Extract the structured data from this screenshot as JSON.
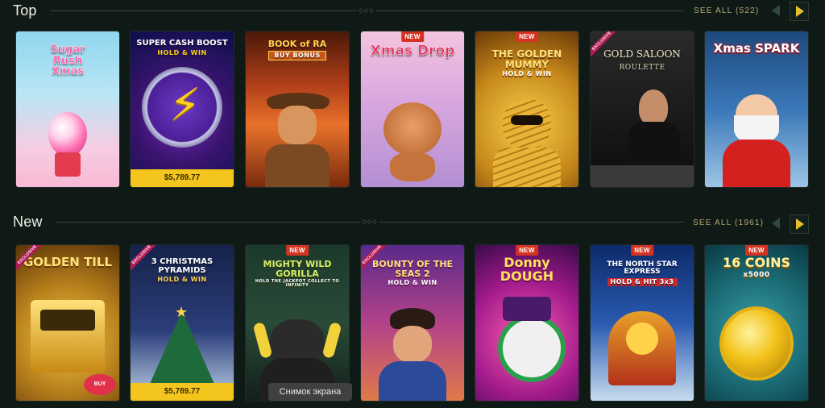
{
  "sections": {
    "top": {
      "title": "Top",
      "see_all": "SEE ALL (522)",
      "games": [
        {
          "name": "Sugar Rush Xmas",
          "logo": "Sugar\nRush\nXmas",
          "badge": "",
          "jackpot": ""
        },
        {
          "name": "Super Cash Boost Hold & Win",
          "logo": "SUPER CASH BOOST",
          "sub": "HOLD & WIN",
          "badge": "",
          "jackpot": "$5,789.77"
        },
        {
          "name": "Book of Ra Buy Bonus",
          "logo": "BOOK of RA",
          "sub": "BUY BONUS",
          "badge": "",
          "jackpot": ""
        },
        {
          "name": "Xmas Drop",
          "logo": "Xmas Drop",
          "badge": "NEW",
          "jackpot": ""
        },
        {
          "name": "The Golden Mummy",
          "logo": "THE GOLDEN MUMMY",
          "sub": "HOLD & WIN",
          "badge": "NEW",
          "jackpot": ""
        },
        {
          "name": "Gold Saloon Roulette",
          "logo": "GOLD SALOON",
          "sub": "ROULETTE",
          "badge": "EXCLUSIVE",
          "jackpot": ""
        },
        {
          "name": "Xmas Spark",
          "logo": "Xmas SPARK",
          "badge": "",
          "jackpot": ""
        }
      ]
    },
    "new": {
      "title": "New",
      "see_all": "SEE ALL (1961)",
      "games": [
        {
          "name": "Golden Till",
          "logo": "GOLDEN TILL",
          "sub": "BUY BONUS",
          "badge": "EXCLUSIVE",
          "jackpot": ""
        },
        {
          "name": "3 Christmas Pyramids Hold & Win",
          "logo": "3 CHRISTMAS PYRAMIDS",
          "sub": "HOLD & WIN",
          "badge": "EXCLUSIVE",
          "jackpot": "$5,789.77"
        },
        {
          "name": "Mighty Wild Gorilla",
          "logo": "MIGHTY WILD GORILLA",
          "sub": "HOLD THE JACKPOT COLLECT TO INFINITY",
          "badge": "NEW",
          "jackpot": ""
        },
        {
          "name": "Bounty of the Seas 2",
          "logo": "BOUNTY OF THE SEAS 2",
          "sub": "HOLD & WIN",
          "badge": "EXCLUSIVE",
          "jackpot": ""
        },
        {
          "name": "Donny Dough",
          "logo": "Donny DOUGH",
          "badge": "NEW",
          "jackpot": ""
        },
        {
          "name": "The North Star Express",
          "logo": "THE NORTH STAR EXPRESS",
          "sub": "HOLD & HIT 3x3",
          "badge": "NEW",
          "jackpot": ""
        },
        {
          "name": "16 Coins x5000",
          "logo": "16 COINS",
          "sub": "x5000",
          "badge": "NEW",
          "jackpot": ""
        }
      ]
    }
  },
  "tooltip": "Снимок экрана",
  "colors": {
    "background": "#0f1a17",
    "accent": "#e2c02a",
    "see_all": "#b6a874",
    "new_badge": "#d53322",
    "exclusive_badge": "#b01c55",
    "jackpot_bar": "#f4c51c"
  }
}
